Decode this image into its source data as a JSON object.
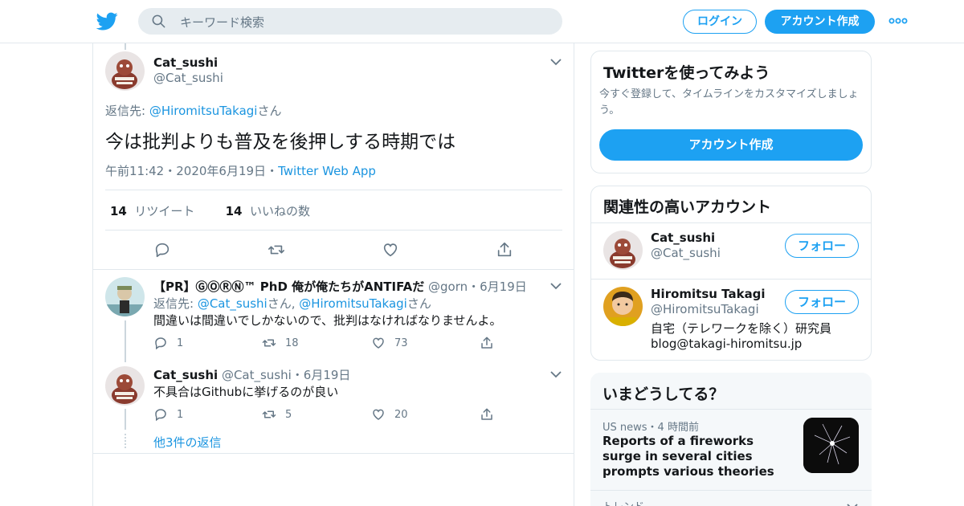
{
  "header": {
    "search_placeholder": "キーワード検索",
    "login_label": "ログイン",
    "signup_label": "アカウント作成",
    "brand_color": "#1da1f2"
  },
  "main_tweet": {
    "name": "Cat_sushi",
    "handle": "@Cat_sushi",
    "reply_prefix": "返信先: ",
    "reply_to": "@HiromitsuTakagi",
    "reply_suffix": "さん",
    "text": "今は批判よりも普及を後押しする時期では",
    "time": "午前11:42",
    "date": "2020年6月19日",
    "source": "Twitter Web App",
    "dot": "・",
    "retweet_count": "14",
    "retweet_label": "リツイート",
    "like_count": "14",
    "like_label": "いいねの数"
  },
  "replies": [
    {
      "name": "【PR】ⒼⓄⓇⓃ™ PhD 俺が俺たちがANTIFAだ",
      "handle": "@gorn",
      "date": "・6月19日",
      "reply_prefix": "返信先: ",
      "reply_to_1": "@Cat_sushi",
      "reply_mid": "さん, ",
      "reply_to_2": "@HiromitsuTakagi",
      "reply_suffix": "さん",
      "text": "間違いは間違いでしかないので、批判はなければなりませんよ。",
      "replies": "1",
      "retweets": "18",
      "likes": "73"
    },
    {
      "name": "Cat_sushi",
      "handle": "@Cat_sushi",
      "date": "・6月19日",
      "text": "不具合はGithubに挙げるのが良い",
      "replies": "1",
      "retweets": "5",
      "likes": "20"
    }
  ],
  "more_replies": "他3件の返信",
  "sidebar": {
    "signup_card": {
      "title": "Twitterを使ってみよう",
      "desc": "今すぐ登録して、タイムラインをカスタマイズしましょう。",
      "button": "アカウント作成"
    },
    "relevant": {
      "title": "関連性の高いアカウント",
      "accounts": [
        {
          "name": "Cat_sushi",
          "handle": "@Cat_sushi",
          "follow": "フォロー"
        },
        {
          "name": "Hiromitsu Takagi",
          "handle": "@HiromitsuTakagi",
          "bio_1": "自宅（テレワークを除く）研究員",
          "bio_2": "blog@takagi-hiromitsu.jp",
          "follow": "フォロー"
        }
      ]
    },
    "trends": {
      "title": "いまどうしてる？",
      "item_meta": "US news・4 時間前",
      "item_title": "Reports of a fireworks surge in several cities prompts various theories",
      "next_meta": "トレンド"
    }
  }
}
